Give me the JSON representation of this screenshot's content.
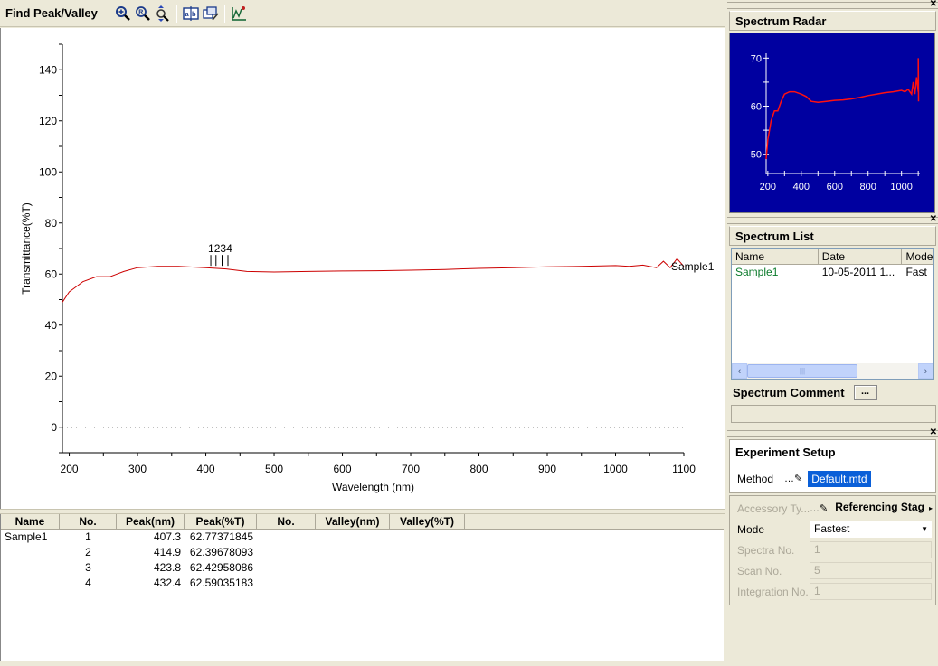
{
  "toolbar": {
    "title": "Find Peak/Valley",
    "icons": [
      "zoom-in-icon",
      "zoom-reset-icon",
      "zoom-vertical-icon",
      "label-ab-icon",
      "copy-edit-icon",
      "peak-settings-icon"
    ]
  },
  "chart_data": {
    "type": "line",
    "title": "",
    "xlabel": "Wavelength (nm)",
    "ylabel": "Transmittance(%T)",
    "xlim": [
      190,
      1100
    ],
    "ylim": [
      -10,
      150
    ],
    "xticks": [
      200,
      300,
      400,
      500,
      600,
      700,
      800,
      900,
      1000,
      1100
    ],
    "yticks": [
      0,
      20,
      40,
      60,
      80,
      100,
      120,
      140
    ],
    "zero_line": "dotted",
    "series": [
      {
        "name": "Sample1",
        "color": "#cc0000",
        "x": [
          190,
          200,
          210,
          220,
          240,
          260,
          280,
          300,
          330,
          360,
          400,
          430,
          460,
          500,
          550,
          600,
          650,
          700,
          750,
          800,
          850,
          900,
          950,
          1000,
          1020,
          1040,
          1060,
          1070,
          1080,
          1090,
          1100
        ],
        "y": [
          49,
          53,
          55,
          57,
          59,
          59,
          61,
          62.5,
          63,
          63,
          62.5,
          62,
          61,
          60.8,
          61,
          61.2,
          61.3,
          61.5,
          61.8,
          62.2,
          62.5,
          62.8,
          63,
          63.3,
          63,
          63.5,
          62.5,
          65,
          62.5,
          66,
          63
        ]
      }
    ],
    "peak_markers": [
      {
        "label": "1",
        "x": 407.3
      },
      {
        "label": "2",
        "x": 414.9
      },
      {
        "label": "3",
        "x": 423.8
      },
      {
        "label": "4",
        "x": 432.4
      }
    ]
  },
  "results_table": {
    "columns": [
      "Name",
      "No.",
      "Peak(nm)",
      "Peak(%T)",
      "No.",
      "Valley(nm)",
      "Valley(%T)"
    ],
    "rows": [
      [
        "Sample1",
        "1",
        "407.3",
        "62.77371845",
        "",
        "",
        ""
      ],
      [
        "",
        "2",
        "414.9",
        "62.39678093",
        "",
        "",
        ""
      ],
      [
        "",
        "3",
        "423.8",
        "62.42958086",
        "",
        "",
        ""
      ],
      [
        "",
        "4",
        "432.4",
        "62.59035183",
        "",
        "",
        ""
      ]
    ]
  },
  "spectrum_radar": {
    "title": "Spectrum Radar",
    "bg_color": "#0000a0",
    "xticks": [
      200,
      400,
      600,
      800,
      1000
    ],
    "yticks": [
      50,
      60,
      70
    ],
    "xlim": [
      190,
      1110
    ],
    "ylim": [
      46,
      71
    ]
  },
  "spectrum_list": {
    "title": "Spectrum List",
    "columns": [
      "Name",
      "Date",
      "Mode"
    ],
    "rows": [
      {
        "name": "Sample1",
        "date": "10-05-2011 1...",
        "mode": "Fast"
      }
    ]
  },
  "spectrum_comment": {
    "label": "Spectrum Comment",
    "button": "...",
    "value": ""
  },
  "experiment_setup": {
    "title": "Experiment Setup",
    "method_label": "Method",
    "method_value": "Default.mtd",
    "accessory_label": "Accessory Ty...",
    "accessory_value": "Referencing Stag",
    "mode_label": "Mode",
    "mode_value": "Fastest",
    "spectra_label": "Spectra No.",
    "spectra_value": "1",
    "scan_label": "Scan No.",
    "scan_value": "5",
    "integration_label": "Integration No.",
    "integration_value": "1"
  }
}
